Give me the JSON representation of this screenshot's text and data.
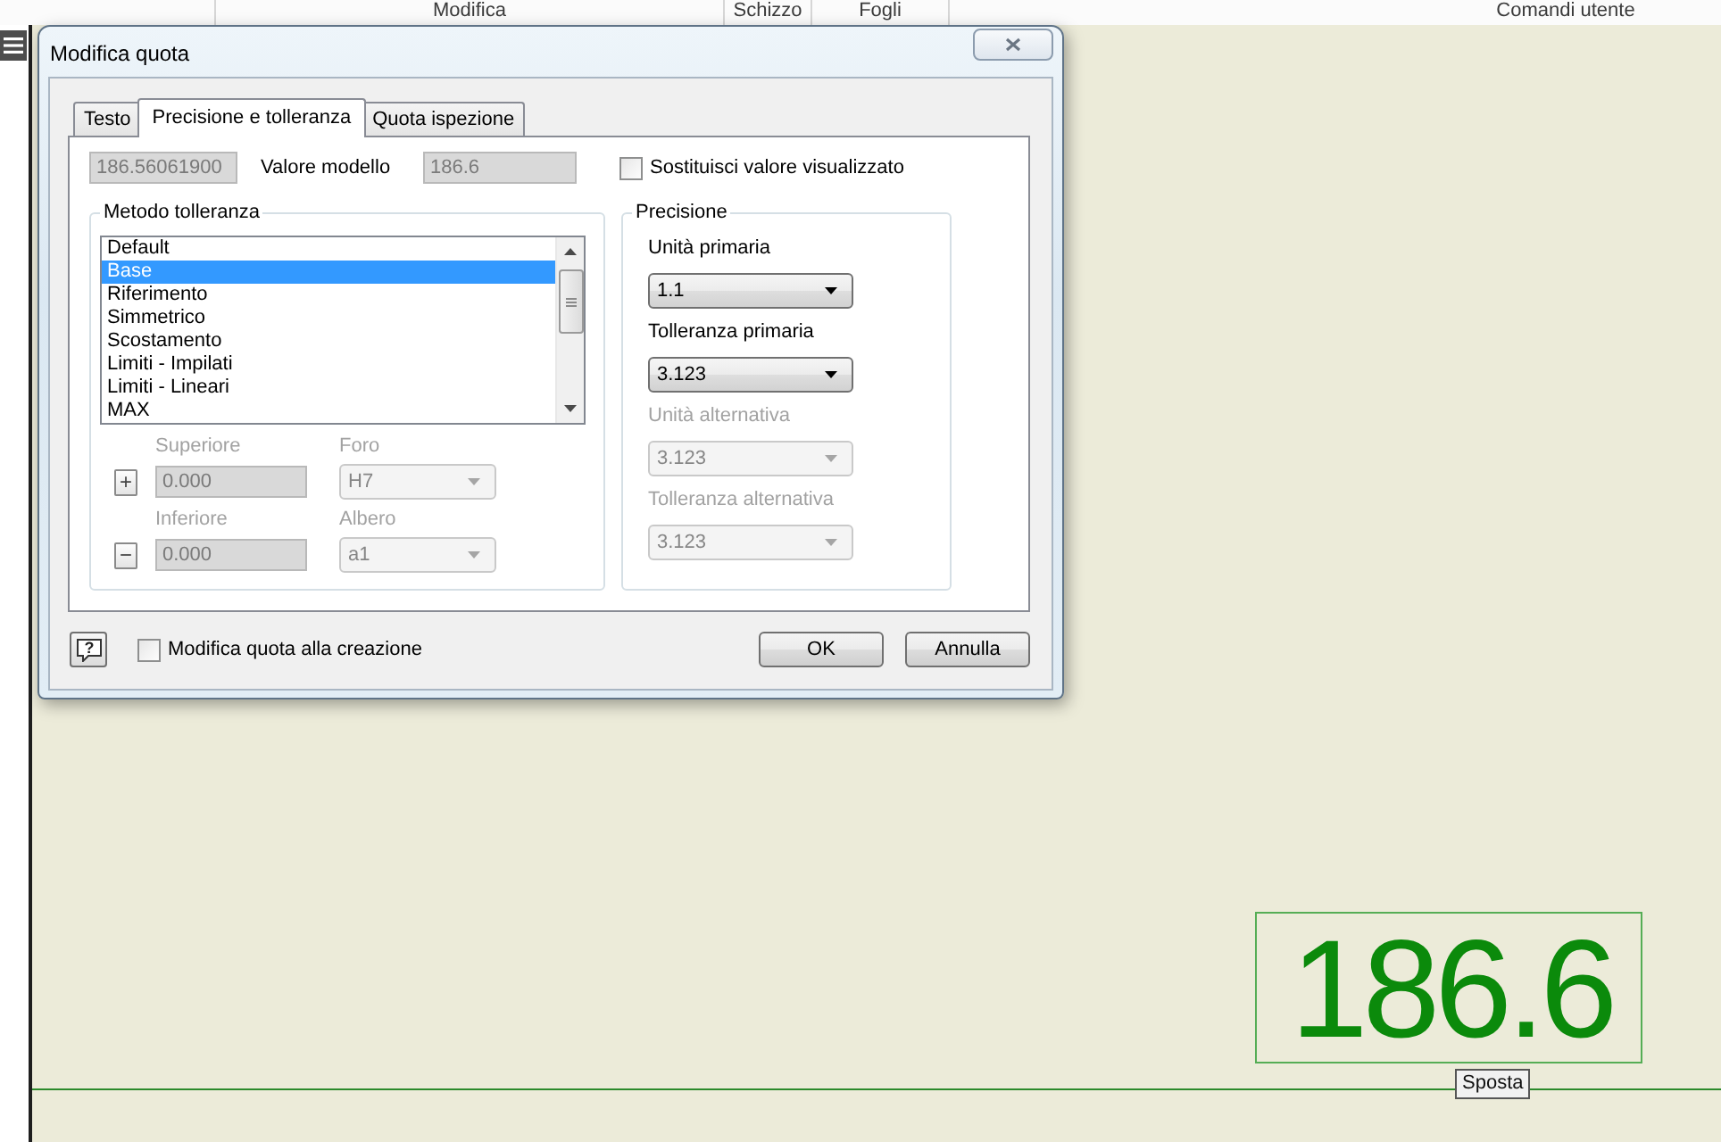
{
  "ribbon": {
    "panels": [
      {
        "label": "Modifica"
      },
      {
        "label": "Schizzo"
      },
      {
        "label": "Fogli"
      },
      {
        "label": "Comandi utente"
      }
    ]
  },
  "dialog": {
    "title": "Modifica quota",
    "tabs": [
      {
        "label": "Testo",
        "selected": false
      },
      {
        "label": "Precisione e tolleranza",
        "selected": true
      },
      {
        "label": "Quota ispezione",
        "selected": false
      }
    ],
    "value_row": {
      "model_value": {
        "value": "186.56061900",
        "disabled": true
      },
      "label": "Valore modello",
      "displayed_value": {
        "value": "186.6",
        "disabled": true
      },
      "override": {
        "label": "Sostituisci valore visualizzato",
        "checked": false
      }
    },
    "tolerance_method": {
      "title": "Metodo tolleranza",
      "items": [
        {
          "label": "Default",
          "selected": false
        },
        {
          "label": "Base",
          "selected": true
        },
        {
          "label": "Riferimento",
          "selected": false
        },
        {
          "label": "Simmetrico",
          "selected": false
        },
        {
          "label": "Scostamento",
          "selected": false
        },
        {
          "label": "Limiti - Impilati",
          "selected": false
        },
        {
          "label": "Limiti - Lineari",
          "selected": false
        },
        {
          "label": "MAX",
          "selected": false
        }
      ],
      "limits": [
        {
          "sign": "+",
          "label": "Superiore",
          "value": "0.000",
          "disabled": true,
          "fit": {
            "label": "Foro",
            "value": "H7",
            "disabled": true
          }
        },
        {
          "sign": "−",
          "label": "Inferiore",
          "value": "0.000",
          "disabled": true,
          "fit": {
            "label": "Albero",
            "value": "a1",
            "disabled": true
          }
        }
      ]
    },
    "precision": {
      "title": "Precisione",
      "fields": [
        {
          "label": "Unità primaria",
          "value": "1.1",
          "disabled": false
        },
        {
          "label": "Tolleranza primaria",
          "value": "3.123",
          "disabled": false
        },
        {
          "label": "Unità alternativa",
          "value": "3.123",
          "disabled": true
        },
        {
          "label": "Tolleranza alternativa",
          "value": "3.123",
          "disabled": true
        }
      ]
    },
    "help": {
      "glyph": "?"
    },
    "edit_on_create": {
      "label": "Modifica quota alla creazione",
      "checked": false
    },
    "buttons": [
      {
        "label": "OK"
      },
      {
        "label": "Annulla"
      }
    ]
  },
  "canvas": {
    "dimension": {
      "value": "186.6"
    },
    "tooltip": "Sposta"
  }
}
